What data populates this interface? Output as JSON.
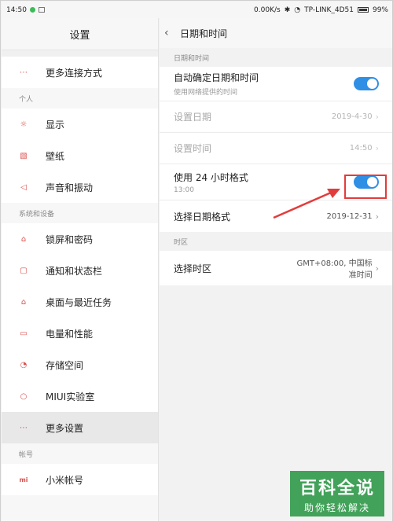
{
  "status_bar": {
    "time": "14:50",
    "net_speed": "0.00K/s",
    "wifi_name": "TP-LINK_4D51",
    "battery": "99%"
  },
  "left": {
    "title": "设置",
    "top_item": "更多连接方式",
    "sections": [
      {
        "label": "个人",
        "items": [
          {
            "label": "显示",
            "icon": "sun-icon"
          },
          {
            "label": "壁纸",
            "icon": "wallpaper-icon"
          },
          {
            "label": "声音和振动",
            "icon": "speaker-icon"
          }
        ]
      },
      {
        "label": "系统和设备",
        "items": [
          {
            "label": "锁屏和密码",
            "icon": "lock-icon"
          },
          {
            "label": "通知和状态栏",
            "icon": "notification-icon"
          },
          {
            "label": "桌面与最近任务",
            "icon": "home-icon"
          },
          {
            "label": "电量和性能",
            "icon": "battery-icon"
          },
          {
            "label": "存储空间",
            "icon": "storage-icon"
          },
          {
            "label": "MIUI实验室",
            "icon": "flask-icon"
          },
          {
            "label": "更多设置",
            "icon": "more-icon",
            "active": true
          }
        ]
      },
      {
        "label": "帐号",
        "items": [
          {
            "label": "小米帐号",
            "icon": "mi-icon"
          }
        ]
      }
    ]
  },
  "right": {
    "title": "日期和时间",
    "section_datetime": "日期和时间",
    "auto_datetime": {
      "title": "自动确定日期和时间",
      "sub": "使用网络提供的时间",
      "on": true
    },
    "set_date": {
      "title": "设置日期",
      "value": "2019-4-30"
    },
    "set_time": {
      "title": "设置时间",
      "value": "14:50"
    },
    "hour24": {
      "title": "使用 24 小时格式",
      "sub": "13:00",
      "on": true
    },
    "date_format": {
      "title": "选择日期格式",
      "value": "2019-12-31"
    },
    "section_timezone": "时区",
    "timezone": {
      "title": "选择时区",
      "value_line1": "GMT+08:00, 中国标",
      "value_line2": "准时间"
    }
  },
  "watermark": {
    "big": "百科全说",
    "small": "助你轻松解决"
  },
  "colors": {
    "accent": "#2f8fe5",
    "annotation": "#e23c3c",
    "icon": "#d9534f",
    "watermark": "#2f9a4a"
  }
}
